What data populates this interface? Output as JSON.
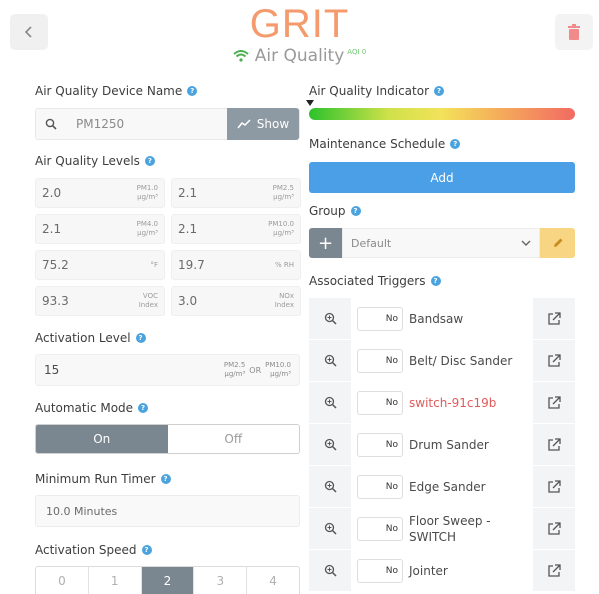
{
  "header": {
    "title": "GRIT",
    "subtitle": "Air Quality",
    "aqi_badge": "AQI 0"
  },
  "left": {
    "device_name_label": "Air Quality Device Name",
    "device_name_value": "PM1250",
    "show_button_label": "Show",
    "levels_label": "Air Quality Levels",
    "levels": [
      {
        "value": "2.0",
        "unit1": "PM1.0",
        "unit2": "μg/m³"
      },
      {
        "value": "2.1",
        "unit1": "PM2.5",
        "unit2": "μg/m³"
      },
      {
        "value": "2.1",
        "unit1": "PM4.0",
        "unit2": "μg/m³"
      },
      {
        "value": "2.1",
        "unit1": "PM10.0",
        "unit2": "μg/m³"
      },
      {
        "value": "75.2",
        "unit1": "°F",
        "unit2": ""
      },
      {
        "value": "19.7",
        "unit1": "% RH",
        "unit2": ""
      },
      {
        "value": "93.3",
        "unit1": "VOC",
        "unit2": "Index"
      },
      {
        "value": "3.0",
        "unit1": "NOx",
        "unit2": "Index"
      }
    ],
    "activation_level_label": "Activation Level",
    "activation_level_value": "15",
    "activation_unit_a1": "PM2.5",
    "activation_unit_a2": "μg/m³",
    "activation_or": "OR",
    "activation_unit_b1": "PM10.0",
    "activation_unit_b2": "μg/m³",
    "automatic_mode_label": "Automatic Mode",
    "auto_on": "On",
    "auto_off": "Off",
    "min_run_label": "Minimum Run Timer",
    "min_run_value": "10.0 Minutes",
    "speed_label": "Activation Speed",
    "speeds": [
      "0",
      "1",
      "2",
      "3",
      "4"
    ],
    "selected_speed": "2"
  },
  "right": {
    "aq_indicator_label": "Air Quality Indicator",
    "maintenance_label": "Maintenance Schedule",
    "add_button_label": "Add",
    "group_label": "Group",
    "group_value": "Default",
    "triggers_label": "Associated Triggers",
    "triggers": [
      {
        "toggle": "No",
        "name": "Bandsaw",
        "red": false
      },
      {
        "toggle": "No",
        "name": "Belt/ Disc Sander",
        "red": false
      },
      {
        "toggle": "No",
        "name": "switch-91c19b",
        "red": true
      },
      {
        "toggle": "No",
        "name": "Drum Sander",
        "red": false
      },
      {
        "toggle": "No",
        "name": "Edge Sander",
        "red": false
      },
      {
        "toggle": "No",
        "name": "Floor Sweep - SWITCH",
        "red": false
      },
      {
        "toggle": "No",
        "name": "Jointer",
        "red": false
      }
    ]
  },
  "colors": {
    "accent_orange": "#f49a6c",
    "add_blue": "#4a9fe6",
    "slate": "#7b8790",
    "pencil_yellow": "#f7d583",
    "warning_red": "#e05a5a"
  }
}
